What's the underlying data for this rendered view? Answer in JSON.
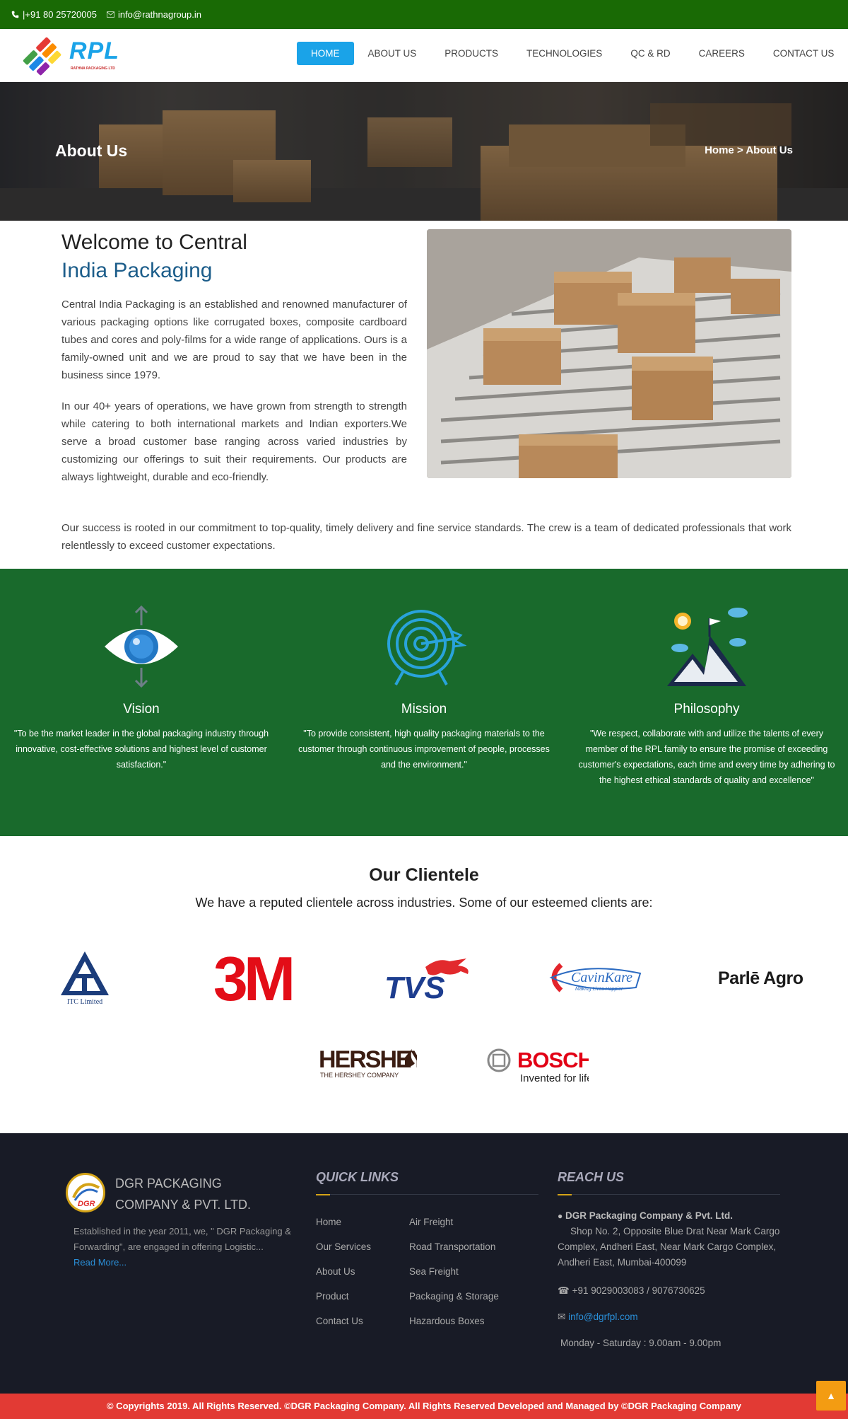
{
  "topbar": {
    "phone": "|+91 80 25720005",
    "email": "info@rathnagroup.in"
  },
  "logo": {
    "text": "RPL",
    "subtitle": "RATHNA PACKAGING LTD"
  },
  "menu": [
    "HOME",
    "ABOUT US",
    "PRODUCTS",
    "TECHNOLOGIES",
    "QC & RD",
    "CAREERS",
    "CONTACT US"
  ],
  "banner": {
    "title": "About Us",
    "crumb_home": "Home",
    "crumb_sep": ">",
    "crumb_current": "About Us"
  },
  "about": {
    "heading_line1": "Welcome to Central",
    "heading_line2": "India Packaging",
    "p1": "Central India Packaging is an established and renowned manufacturer of various packaging options like corrugated boxes, composite cardboard tubes and cores and poly-films for a wide range of applications. Ours is a family-owned unit and we are proud to say that we have been in the business since 1979.",
    "p2": "In our 40+ years of operations, we have grown from strength to strength while catering to both international markets and Indian exporters.We serve a broad customer base ranging across varied industries by customizing our offerings to suit their requirements. Our products are always lightweight, durable and eco-friendly.",
    "p3": "Our success is rooted in our commitment to top-quality, timely delivery and fine service standards. The crew is a team of dedicated professionals that work relentlessly to exceed customer expectations."
  },
  "values": [
    {
      "title": "Vision",
      "icon": "eye-icon",
      "text": "\"To be the market leader in the global packaging industry through innovative, cost-effective solutions and highest level of customer satisfaction.\""
    },
    {
      "title": "Mission",
      "icon": "target-icon",
      "text": "\"To provide consistent, high quality packaging materials to the customer through continuous improvement of people, processes and the environment.\""
    },
    {
      "title": "Philosophy",
      "icon": "mountain-flag-icon",
      "text": "\"We respect, collaborate with and utilize the talents of every member of the RPL family to ensure the promise of exceeding customer's expectations, each time and every time by adhering to the highest ethical standards of quality and excellence\""
    }
  ],
  "clientele": {
    "title": "Our Clientele",
    "subtitle": "We have a reputed clientele across industries. Some of our esteemed clients are:",
    "clients": {
      "itc": "ITC Limited",
      "m3": "3M",
      "tvs": "TVS",
      "cavinkare": "CavinKare",
      "cavinkare_tag": "Making Lives Happier",
      "parle": "Parlē Agro",
      "hershey": "HERSHEY",
      "hershey_tag": "THE HERSHEY COMPANY",
      "bosch": "BOSCH",
      "bosch_tag": "Invented for life"
    }
  },
  "footer": {
    "company": "DGR PACKAGING COMPANY & PVT. LTD.",
    "logo_text": "DGR",
    "desc": "Established in the year 2011, we, \" DGR Packaging & Forwarding\", are engaged in offering Logistic...",
    "read_more": "Read More...",
    "quick_links_title": "QUICK LINKS",
    "links_col1": [
      "Home",
      "Our Services",
      "About Us",
      "Product",
      "Contact Us"
    ],
    "links_col2": [
      "Air Freight",
      "Road Transportation",
      "Sea Freight",
      "Packaging & Storage",
      "Hazardous Boxes"
    ],
    "reach_title": "REACH US",
    "reach_company": "DGR Packaging Company & Pvt. Ltd.",
    "address": "Shop No. 2, Opposite Blue Drat Near Mark Cargo Complex, Andheri East, Near Mark Cargo Complex, Andheri East, Mumbai-400099",
    "phone": "+91 9029003083 / 9076730625",
    "email": "info@dgrfpl.com",
    "hours": "Monday - Saturday : 9.00am - 9.00pm",
    "copyright": "© Copyrights 2019. All Rights Reserved. ©DGR Packaging Company. All Rights Reserved Developed and Managed by ©DGR Packaging Company"
  },
  "colors": {
    "topbar": "#196a05",
    "accent": "#1aa3e8",
    "values_bg": "#196a2c",
    "footer_bg": "#181b26",
    "copyright_bg": "#e23a34",
    "gold": "#d4a317"
  }
}
